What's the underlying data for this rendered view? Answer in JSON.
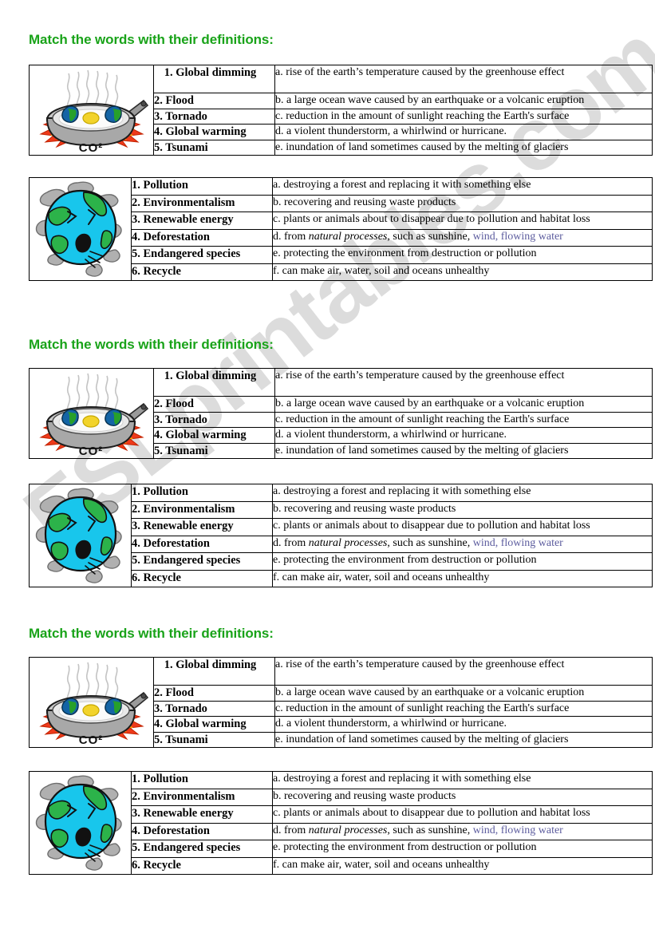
{
  "page": {
    "heading_text": "Match the words with their definitions:",
    "watermark": "ESLprintables.com",
    "heading_color": "#19a319",
    "link_color": "#5c5c9e"
  },
  "illustrations": {
    "frying_pan": {
      "name": "frying-pan-earth-co2-illustration",
      "caption": "CO²"
    },
    "coughing_earth": {
      "name": "coughing-earth-pollution-illustration"
    }
  },
  "table_a": {
    "terms": [
      "1. Global dimming",
      "2. Flood",
      "3. Tornado",
      "4. Global warming",
      "5. Tsunami"
    ],
    "definitions": [
      "a. rise of the earth’s temperature caused by the greenhouse effect",
      "b. a large ocean wave caused by an earthquake or a volcanic eruption",
      "c. reduction in the amount of sunlight reaching the Earth's surface",
      "d. a violent thunderstorm, a whirlwind or hurricane.",
      "e. inundation of land sometimes caused by the melting of glaciers"
    ]
  },
  "table_b": {
    "terms": [
      "1. Pollution",
      "2. Environmentalism",
      "3. Renewable energy",
      "4. Deforestation",
      "5. Endangered species",
      "6. Recycle"
    ],
    "definitions": [
      "a. destroying a forest and replacing it with something else",
      "b. recovering and reusing waste products",
      "c. plants or animals about to disappear due to pollution and habitat loss",
      "e. protecting the environment from destruction or pollution",
      "f.  can make air, water, soil and oceans unhealthy"
    ],
    "definition_d": {
      "prefix": "d. from ",
      "italic": "natural processes",
      "middle": ", such as sunshine, ",
      "link": "wind, flowing water"
    }
  },
  "sections": [
    {
      "id": "section-1"
    },
    {
      "id": "section-2"
    },
    {
      "id": "section-3"
    }
  ]
}
